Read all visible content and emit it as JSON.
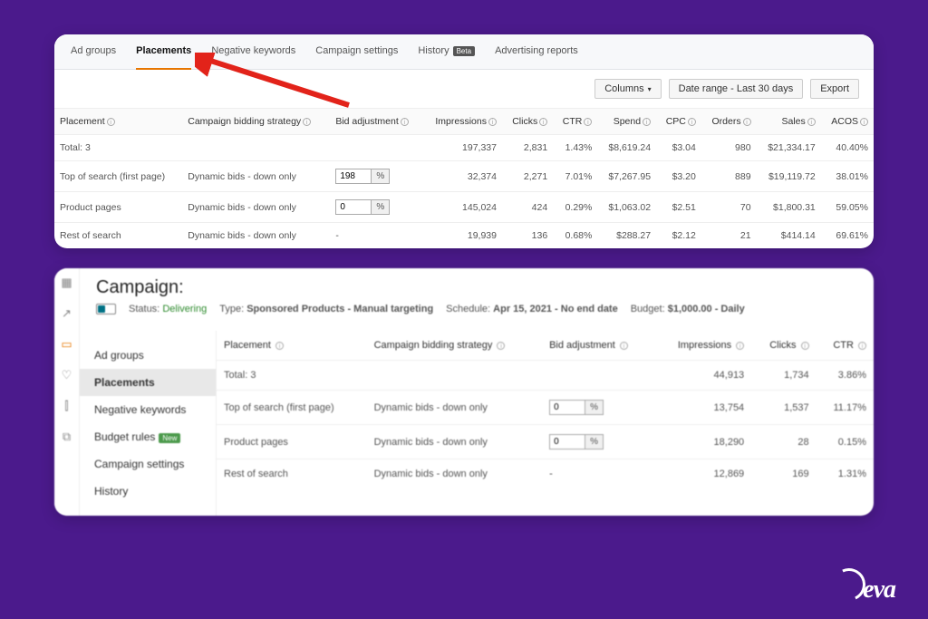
{
  "top": {
    "tabs": [
      "Ad groups",
      "Placements",
      "Negative keywords",
      "Campaign settings",
      "History",
      "Advertising reports"
    ],
    "active_tab_index": 1,
    "history_beta": "Beta",
    "toolbar": {
      "columns": "Columns",
      "date_range": "Date range - Last 30 days",
      "export": "Export"
    },
    "headers": [
      "Placement",
      "Campaign bidding strategy",
      "Bid adjustment",
      "Impressions",
      "Clicks",
      "CTR",
      "Spend",
      "CPC",
      "Orders",
      "Sales",
      "ACOS"
    ],
    "total_label": "Total: 3",
    "total": {
      "impressions": "197,337",
      "clicks": "2,831",
      "ctr": "1.43%",
      "spend": "$8,619.24",
      "cpc": "$3.04",
      "orders": "980",
      "sales": "$21,334.17",
      "acos": "40.40%"
    },
    "rows": [
      {
        "placement": "Top of search (first page)",
        "strategy": "Dynamic bids - down only",
        "bid": "198",
        "impressions": "32,374",
        "clicks": "2,271",
        "ctr": "7.01%",
        "spend": "$7,267.95",
        "cpc": "$3.20",
        "orders": "889",
        "sales": "$19,119.72",
        "acos": "38.01%"
      },
      {
        "placement": "Product pages",
        "strategy": "Dynamic bids - down only",
        "bid": "0",
        "impressions": "145,024",
        "clicks": "424",
        "ctr": "0.29%",
        "spend": "$1,063.02",
        "cpc": "$2.51",
        "orders": "70",
        "sales": "$1,800.31",
        "acos": "59.05%"
      },
      {
        "placement": "Rest of search",
        "strategy": "Dynamic bids - down only",
        "bid": "-",
        "impressions": "19,939",
        "clicks": "136",
        "ctr": "0.68%",
        "spend": "$288.27",
        "cpc": "$2.12",
        "orders": "21",
        "sales": "$414.14",
        "acos": "69.61%"
      }
    ],
    "pct_label": "%"
  },
  "bottom": {
    "title": "Campaign:",
    "status_label": "Status:",
    "status_value": "Delivering",
    "type_label": "Type:",
    "type_value": "Sponsored Products - Manual targeting",
    "schedule_label": "Schedule:",
    "schedule_value": "Apr 15, 2021 - No end date",
    "budget_label": "Budget:",
    "budget_value": "$1,000.00 - Daily",
    "sidenav": [
      "Ad groups",
      "Placements",
      "Negative keywords",
      "Budget rules",
      "Campaign settings",
      "History"
    ],
    "sidenav_active": 1,
    "badge_new": "New",
    "headers": [
      "Placement",
      "Campaign bidding strategy",
      "Bid adjustment",
      "Impressions",
      "Clicks",
      "CTR"
    ],
    "total_label": "Total: 3",
    "total": {
      "impressions": "44,913",
      "clicks": "1,734",
      "ctr": "3.86%"
    },
    "rows": [
      {
        "placement": "Top of search (first page)",
        "strategy": "Dynamic bids - down only",
        "bid": "0",
        "impressions": "13,754",
        "clicks": "1,537",
        "ctr": "11.17%"
      },
      {
        "placement": "Product pages",
        "strategy": "Dynamic bids - down only",
        "bid": "0",
        "impressions": "18,290",
        "clicks": "28",
        "ctr": "0.15%"
      },
      {
        "placement": "Rest of search",
        "strategy": "Dynamic bids - down only",
        "bid": "-",
        "impressions": "12,869",
        "clicks": "169",
        "ctr": "1.31%"
      }
    ],
    "pct_label": "%"
  },
  "logo": "eva"
}
